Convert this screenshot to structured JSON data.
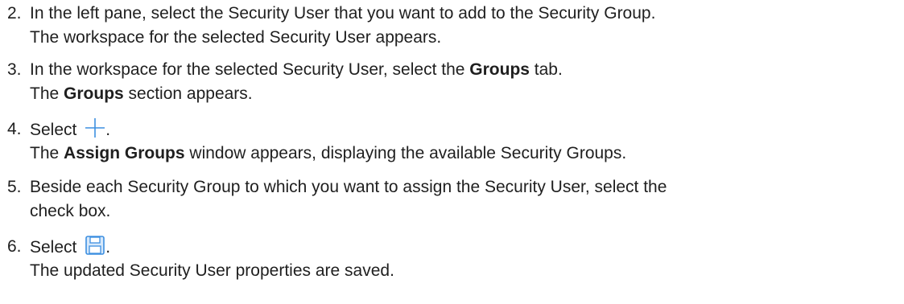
{
  "steps": [
    {
      "number": "2.",
      "line1": "In the left pane, select the Security User that you want to add to the Security Group.",
      "line2": "The workspace for the selected Security User appears."
    },
    {
      "number": "3.",
      "line1_pre": "In the workspace for the selected Security User, select the ",
      "line1_bold": "Groups",
      "line1_post": " tab.",
      "line2_pre": "The ",
      "line2_bold": "Groups",
      "line2_post": " section appears."
    },
    {
      "number": "4.",
      "line1_pre": "Select ",
      "line1_post": ".",
      "icon": "plus-icon",
      "line2_pre": "The ",
      "line2_bold": "Assign Groups",
      "line2_post": " window appears, displaying the available Security Groups."
    },
    {
      "number": "5.",
      "line1": "Beside each Security Group to which you want to assign the Security User, select the",
      "line2": "check box."
    },
    {
      "number": "6.",
      "line1_pre": "Select ",
      "line1_post": ".",
      "icon": "save-icon",
      "line2": "The updated Security User properties are saved."
    }
  ],
  "colors": {
    "text": "#1f1f1f",
    "icon_accent": "#3d8fe0"
  }
}
